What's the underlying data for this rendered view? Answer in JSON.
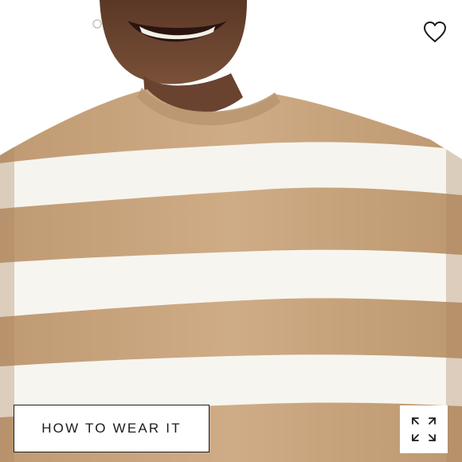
{
  "product_image": {
    "alt": "",
    "colors": {
      "camel": "#c9a57f",
      "ivory": "#f6f4ee",
      "skin": "#6b4530"
    }
  },
  "favorite": {
    "icon": "heart-outline-icon",
    "color": "#1b1b1b"
  },
  "how_to_wear": {
    "label": "HOW TO WEAR IT"
  },
  "expand": {
    "icon": "expand-arrows-icon",
    "color": "#1b1b1b"
  }
}
